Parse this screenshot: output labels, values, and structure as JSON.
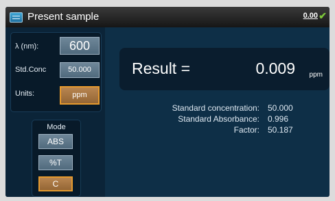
{
  "header": {
    "title": "Present sample",
    "status_value": "0.00"
  },
  "settings": {
    "wavelength_label": "λ (nm):",
    "wavelength_value": "600",
    "std_conc_label": "Std.Conc",
    "std_conc_value": "50.000",
    "units_label": "Units:",
    "units_value": "ppm"
  },
  "mode": {
    "title": "Mode",
    "options": [
      "ABS",
      "%T",
      "C"
    ],
    "selected": "C"
  },
  "result": {
    "label": "Result =",
    "value": "0.009",
    "unit": "ppm"
  },
  "details": [
    {
      "label": "Standard concentration:",
      "value": "50.000"
    },
    {
      "label": "Standard Absorbance:",
      "value": "0.996"
    },
    {
      "label": "Factor:",
      "value": "50.187"
    }
  ],
  "colors": {
    "screen_bg": "#0e2f47",
    "accent": "#e69a2e",
    "status_ok": "#7ec93a"
  },
  "icons": [
    "sample-list-icon",
    "checkmark-icon"
  ]
}
